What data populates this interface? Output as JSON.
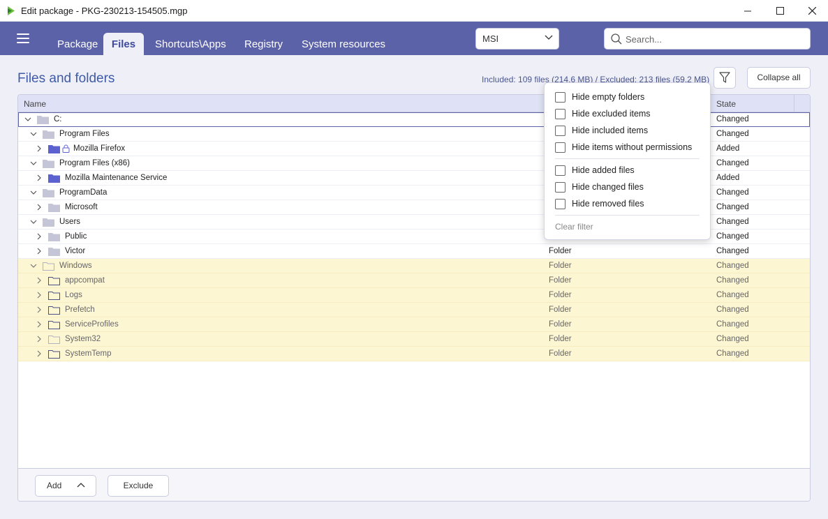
{
  "window": {
    "title": "Edit package - PKG-230213-154505.mgp"
  },
  "tabs": [
    {
      "label": "Package"
    },
    {
      "label": "Files"
    },
    {
      "label": "Shortcuts\\Apps"
    },
    {
      "label": "Registry"
    },
    {
      "label": "System resources"
    }
  ],
  "format_select": {
    "value": "MSI"
  },
  "search": {
    "placeholder": "Search..."
  },
  "section": {
    "title": "Files and folders",
    "stats": "Included: 109 files (214.6 MB) / Excluded: 213 files (59.2 MB)",
    "collapse_label": "Collapse all"
  },
  "table": {
    "columns": {
      "name": "Name",
      "state": "State"
    },
    "rows": [
      {
        "name": "C:",
        "type": "",
        "state": "Changed"
      },
      {
        "name": "Program Files",
        "type": "",
        "state": "Changed"
      },
      {
        "name": "Mozilla Firefox",
        "type": "",
        "state": "Added"
      },
      {
        "name": "Program Files (x86)",
        "type": "",
        "state": "Changed"
      },
      {
        "name": "Mozilla Maintenance Service",
        "type": "",
        "state": "Added"
      },
      {
        "name": "ProgramData",
        "type": "",
        "state": "Changed"
      },
      {
        "name": "Microsoft",
        "type": "",
        "state": "Changed"
      },
      {
        "name": "Users",
        "type": "",
        "state": "Changed"
      },
      {
        "name": "Public",
        "type": "",
        "state": "Changed"
      },
      {
        "name": "Victor",
        "type": "Folder",
        "state": "Changed"
      },
      {
        "name": "Windows",
        "type": "Folder",
        "state": "Changed"
      },
      {
        "name": "appcompat",
        "type": "Folder",
        "state": "Changed"
      },
      {
        "name": "Logs",
        "type": "Folder",
        "state": "Changed"
      },
      {
        "name": "Prefetch",
        "type": "Folder",
        "state": "Changed"
      },
      {
        "name": "ServiceProfiles",
        "type": "Folder",
        "state": "Changed"
      },
      {
        "name": "System32",
        "type": "Folder",
        "state": "Changed"
      },
      {
        "name": "SystemTemp",
        "type": "Folder",
        "state": "Changed"
      }
    ]
  },
  "footer": {
    "add_label": "Add",
    "exclude_label": "Exclude"
  },
  "filter_menu": {
    "options": [
      "Hide empty folders",
      "Hide excluded items",
      "Hide included items",
      "Hide items without permissions",
      "Hide added files",
      "Hide changed files",
      "Hide removed files"
    ],
    "clear_label": "Clear filter"
  },
  "colors": {
    "header": "#5b62a8",
    "accent": "#3e5aa8",
    "folder_included": "#5b62d0",
    "folder_gray": "#c4c6d8",
    "highlight_row": "#fdf6d3"
  }
}
